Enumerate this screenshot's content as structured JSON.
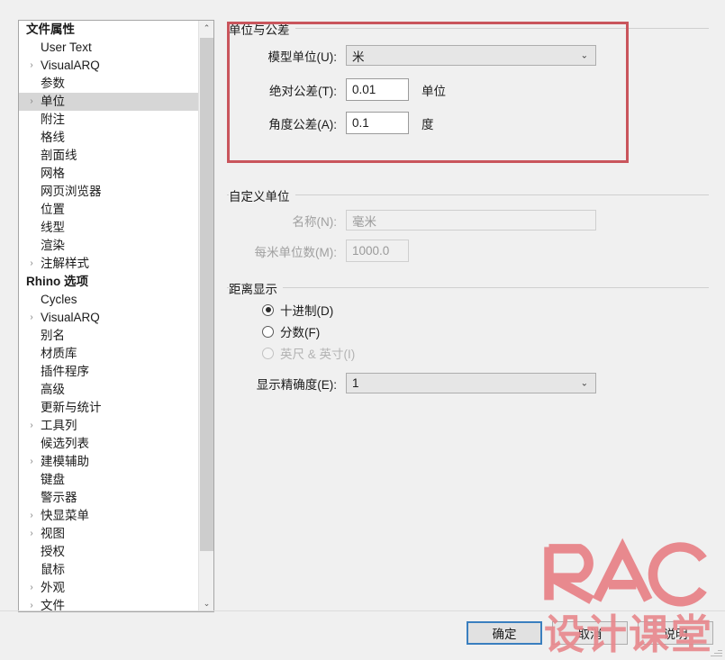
{
  "window": {
    "background_color": "#f0f0f0"
  },
  "sidebar": {
    "sections": [
      {
        "header": "文件属性",
        "items": [
          {
            "label": "User Text",
            "expandable": false,
            "selected": false
          },
          {
            "label": "VisualARQ",
            "expandable": true,
            "selected": false
          },
          {
            "label": "参数",
            "expandable": false,
            "selected": false
          },
          {
            "label": "单位",
            "expandable": true,
            "selected": true
          },
          {
            "label": "附注",
            "expandable": false,
            "selected": false
          },
          {
            "label": "格线",
            "expandable": false,
            "selected": false
          },
          {
            "label": "剖面线",
            "expandable": false,
            "selected": false
          },
          {
            "label": "网格",
            "expandable": false,
            "selected": false
          },
          {
            "label": "网页浏览器",
            "expandable": false,
            "selected": false
          },
          {
            "label": "位置",
            "expandable": false,
            "selected": false
          },
          {
            "label": "线型",
            "expandable": false,
            "selected": false
          },
          {
            "label": "渲染",
            "expandable": false,
            "selected": false
          },
          {
            "label": "注解样式",
            "expandable": true,
            "selected": false
          }
        ]
      },
      {
        "header": "Rhino 选项",
        "items": [
          {
            "label": "Cycles",
            "expandable": false,
            "selected": false
          },
          {
            "label": "VisualARQ",
            "expandable": true,
            "selected": false
          },
          {
            "label": "别名",
            "expandable": false,
            "selected": false
          },
          {
            "label": "材质库",
            "expandable": false,
            "selected": false
          },
          {
            "label": "插件程序",
            "expandable": false,
            "selected": false
          },
          {
            "label": "高级",
            "expandable": false,
            "selected": false
          },
          {
            "label": "更新与统计",
            "expandable": false,
            "selected": false
          },
          {
            "label": "工具列",
            "expandable": true,
            "selected": false
          },
          {
            "label": "候选列表",
            "expandable": false,
            "selected": false
          },
          {
            "label": "建模辅助",
            "expandable": true,
            "selected": false
          },
          {
            "label": "键盘",
            "expandable": false,
            "selected": false
          },
          {
            "label": "警示器",
            "expandable": false,
            "selected": false
          },
          {
            "label": "快显菜单",
            "expandable": true,
            "selected": false
          },
          {
            "label": "视图",
            "expandable": true,
            "selected": false
          },
          {
            "label": "授权",
            "expandable": false,
            "selected": false
          },
          {
            "label": "鼠标",
            "expandable": false,
            "selected": false
          },
          {
            "label": "外观",
            "expandable": true,
            "selected": false
          },
          {
            "label": "文件",
            "expandable": true,
            "selected": false
          }
        ]
      }
    ],
    "scrollbar": {
      "up_arrow": "⌃",
      "down_arrow": "⌄"
    },
    "expand_chevron": "›"
  },
  "units_group": {
    "title": "单位与公差",
    "highlight_color": "#c9555c",
    "model_units": {
      "label": "模型单位(U):",
      "value": "米",
      "chevron": "⌄"
    },
    "absolute_tolerance": {
      "label": "绝对公差(T):",
      "value": "0.01",
      "suffix": "单位"
    },
    "angle_tolerance": {
      "label": "角度公差(A):",
      "value": "0.1",
      "suffix": "度"
    }
  },
  "custom_units_group": {
    "title": "自定义单位",
    "name": {
      "label": "名称(N):",
      "value": "毫米",
      "disabled": true
    },
    "units_per_meter": {
      "label": "每米单位数(M):",
      "value": "1000.0",
      "disabled": true
    }
  },
  "distance_display_group": {
    "title": "距离显示",
    "options": [
      {
        "label": "十进制(D)",
        "checked": true,
        "disabled": false
      },
      {
        "label": "分数(F)",
        "checked": false,
        "disabled": false
      },
      {
        "label": "英尺 & 英寸(I)",
        "checked": false,
        "disabled": true
      }
    ],
    "precision": {
      "label": "显示精确度(E):",
      "value": "1",
      "chevron": "⌄"
    }
  },
  "footer": {
    "ok_label": "确定",
    "cancel_label": "取消",
    "help_label": "说明"
  },
  "watermark": {
    "logo_text": "RAC",
    "sub_text": "设计课堂",
    "color": "#e8898e"
  }
}
